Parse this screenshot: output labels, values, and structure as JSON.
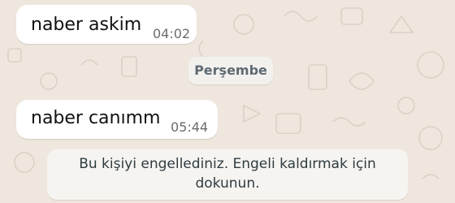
{
  "chat": {
    "messages": [
      {
        "text": "naber askim",
        "time": "04:02"
      },
      {
        "text": "naber canımm",
        "time": "05:44"
      }
    ],
    "date_separator": "Perşembe",
    "blocked_notice": {
      "line1": "Bu kişiyi engellediniz. Engeli kaldırmak için",
      "line2": "dokunun."
    }
  },
  "colors": {
    "wallpaper": "#efe7de",
    "bubble": "#ffffff",
    "doodle": "#d9cfc4"
  }
}
